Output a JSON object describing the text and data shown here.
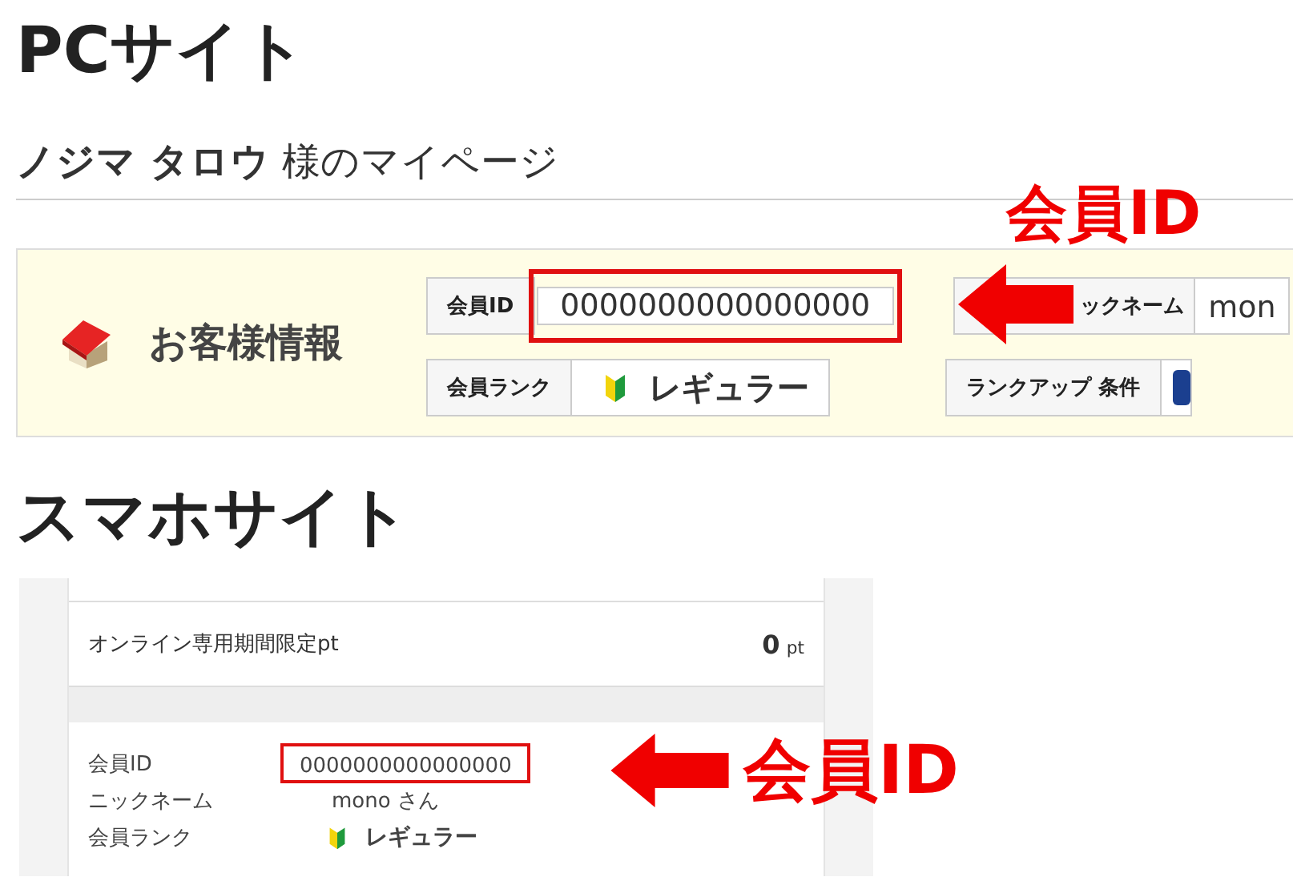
{
  "pc": {
    "heading": "PCサイト",
    "greeting": {
      "name": "ノジマ タロウ",
      "suffix": "様のマイページ"
    },
    "annotation": {
      "text": "会員ID"
    },
    "panel": {
      "title": "お客様情報",
      "rows": [
        [
          {
            "label": "会員ID",
            "value": "0000000000000000",
            "kind": "text",
            "highlighted": true
          },
          {
            "label": "ックネーム",
            "value": "mon",
            "kind": "text",
            "highlighted": false
          }
        ],
        [
          {
            "label": "会員ランク",
            "value": "レギュラー",
            "kind": "rank",
            "highlighted": false
          },
          {
            "label": "ランクアップ 条件",
            "kind": "badge",
            "highlighted": false
          }
        ]
      ]
    }
  },
  "smartphone": {
    "heading": "スマホサイト",
    "annotation": {
      "text": "会員ID"
    },
    "points": {
      "label": "オンライン専用期間限定pt",
      "value": "0",
      "unit": "pt"
    },
    "member": [
      {
        "label": "会員ID",
        "value": "0000000000000000",
        "kind": "text",
        "highlighted": true
      },
      {
        "label": "ニックネーム",
        "value": "mono さん",
        "kind": "text",
        "highlighted": false
      },
      {
        "label": "会員ランク",
        "value": "レギュラー",
        "kind": "rank",
        "highlighted": false
      }
    ]
  }
}
